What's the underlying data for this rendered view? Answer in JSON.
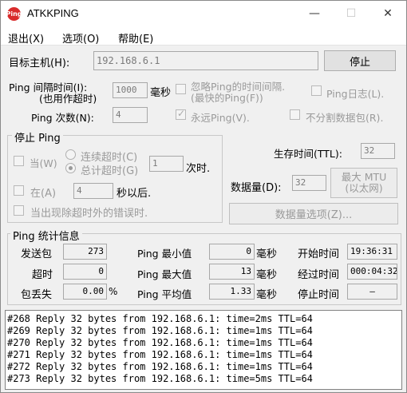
{
  "window": {
    "title": "ATKKPING",
    "icon_text": "Ping",
    "minimize_glyph": "—",
    "maximize_glyph": "☐",
    "close_glyph": "✕"
  },
  "menu": [
    "退出(X)",
    "选项(O)",
    "帮助(E)"
  ],
  "target": {
    "label": "目标主机(H):",
    "value": "192.168.6.1",
    "stop_button": "停止"
  },
  "interval": {
    "label_line1": "Ping 间隔时间(I):",
    "label_line2": "(也用作超时)",
    "value": "1000",
    "unit": "毫秒",
    "ignore_label_line1": "忽略Ping的时间间隔.",
    "ignore_label_line2": "(最快的Ping(F))",
    "ping_log_label": "Ping日志(L)."
  },
  "count": {
    "label": "Ping 次数(N):",
    "value": "4",
    "forever_label": "永远Ping(V).",
    "nofrag_label": "不分割数据包(R)."
  },
  "stop_group": {
    "title": "停止 Ping",
    "when_label": "当(W)",
    "consecutive_label": "连续超时(C)",
    "total_label": "总计超时(G)",
    "times_value": "1",
    "times_unit": "次时.",
    "at_label": "在(A)",
    "seconds_value": "4",
    "seconds_unit": "秒以后.",
    "error_label": "当出现除超时外的错误时."
  },
  "ttl": {
    "label": "生存时间(TTL):",
    "value": "32"
  },
  "packet": {
    "label": "数据量(D):",
    "value": "32",
    "max_mtu_line1": "最大 MTU",
    "max_mtu_line2": "(以太网)",
    "options_button": "数据量选项(Z)..."
  },
  "stats": {
    "title": "Ping  统计信息",
    "sent_label": "发送包",
    "sent_value": "273",
    "timeout_label": "超时",
    "timeout_value": "0",
    "loss_label": "包丢失",
    "loss_value": "0.00",
    "loss_unit": "%",
    "min_label": "Ping 最小值",
    "min_value": "0",
    "max_label": "Ping 最大值",
    "max_value": "13",
    "avg_label": "Ping 平均值",
    "avg_value": "1.33",
    "ms_unit": "毫秒",
    "start_label": "开始时间",
    "start_value": "19:36:31",
    "elapsed_label": "经过时间",
    "elapsed_value": "000:04:32",
    "stop_label": "停止时间",
    "stop_value": "—"
  },
  "log_lines": [
    "#268 Reply 32 bytes from 192.168.6.1: time=2ms TTL=64",
    "#269 Reply 32 bytes from 192.168.6.1: time=1ms TTL=64",
    "#270 Reply 32 bytes from 192.168.6.1: time=1ms TTL=64",
    "#271 Reply 32 bytes from 192.168.6.1: time=1ms TTL=64",
    "#272 Reply 32 bytes from 192.168.6.1: time=1ms TTL=64",
    "#273 Reply 32 bytes from 192.168.6.1: time=5ms TTL=64"
  ]
}
